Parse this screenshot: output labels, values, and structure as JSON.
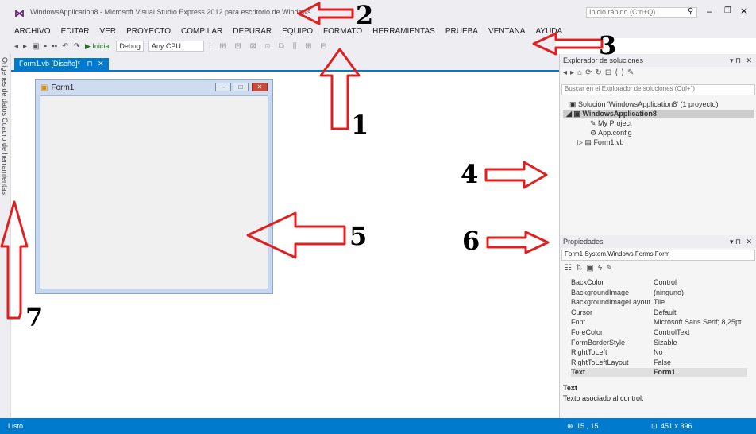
{
  "window": {
    "title": "WindowsApplication8 - Microsoft Visual Studio Express 2012 para escritorio de Windows",
    "quick_launch_placeholder": "Inicio rápido (Ctrl+Q)"
  },
  "menu": [
    "ARCHIVO",
    "EDITAR",
    "VER",
    "PROYECTO",
    "COMPILAR",
    "DEPURAR",
    "EQUIPO",
    "FORMATO",
    "HERRAMIENTAS",
    "PRUEBA",
    "VENTANA",
    "AYUDA"
  ],
  "toolbar": {
    "start_label": "▶ Iniciar",
    "config": "Debug",
    "platform": "Any CPU"
  },
  "left_tabs": [
    "Orígenes de datos",
    "Cuadro de herramientas"
  ],
  "doc_tab": "Form1.vb [Diseño]*",
  "form": {
    "title": "Form1"
  },
  "solution_explorer": {
    "title": "Explorador de soluciones",
    "search_placeholder": "Buscar en el Explorador de soluciones (Ctrl+´)",
    "items": [
      "Solución 'WindowsApplication8' (1 proyecto)",
      "WindowsApplication8",
      "My Project",
      "App.config",
      "Form1.vb"
    ]
  },
  "properties": {
    "title": "Propiedades",
    "object": "Form1  System.Windows.Forms.Form",
    "rows": [
      {
        "name": "BackColor",
        "value": "Control"
      },
      {
        "name": "BackgroundImage",
        "value": "(ninguno)"
      },
      {
        "name": "BackgroundImageLayout",
        "value": "Tile"
      },
      {
        "name": "Cursor",
        "value": "Default"
      },
      {
        "name": "Font",
        "value": "Microsoft Sans Serif; 8,25pt"
      },
      {
        "name": "ForeColor",
        "value": "ControlText"
      },
      {
        "name": "FormBorderStyle",
        "value": "Sizable"
      },
      {
        "name": "RightToLeft",
        "value": "No"
      },
      {
        "name": "RightToLeftLayout",
        "value": "False"
      },
      {
        "name": "Text",
        "value": "Form1"
      }
    ],
    "desc_title": "Text",
    "desc_text": "Texto asociado al control."
  },
  "status": {
    "left": "Listo",
    "pos": "15 , 15",
    "size": "451 x 396"
  },
  "annotations": [
    "1",
    "2",
    "3",
    "4",
    "5",
    "6",
    "7"
  ],
  "colors": {
    "accent": "#007acc",
    "arrow": "#e02020"
  }
}
